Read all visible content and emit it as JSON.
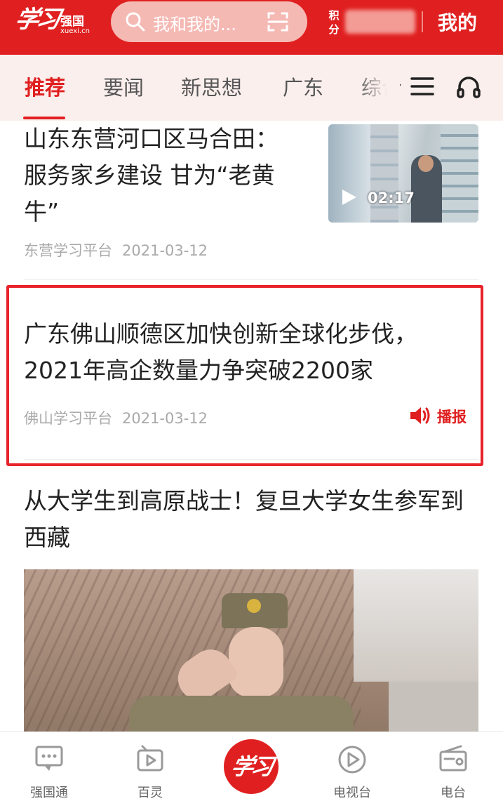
{
  "header": {
    "logo_script": "学习",
    "logo_cn": "强国",
    "logo_en": "xuexi.cn",
    "search_placeholder": "我和我的...",
    "points_label": "积分",
    "mine_label": "我的"
  },
  "tabs": [
    {
      "label": "推荐",
      "active": true
    },
    {
      "label": "要闻",
      "active": false
    },
    {
      "label": "新思想",
      "active": false
    },
    {
      "label": "广东",
      "active": false
    },
    {
      "label": "综合",
      "active": false
    }
  ],
  "feed": [
    {
      "title_lines": [
        "山东东营河口区马合田：",
        "服务家乡建设 甘为“老黄",
        "牛”"
      ],
      "source": "东营学习平台",
      "date": "2021-03-12",
      "video_duration": "02:17"
    },
    {
      "title_lines": [
        "广东佛山顺德区加快创新全球化步伐，",
        "2021年高企数量力争突破2200家"
      ],
      "source": "佛山学习平台",
      "date": "2021-03-12",
      "broadcast_label": "播报"
    },
    {
      "title_lines": [
        "从大学生到高原战士！复旦大学女生参军到",
        "西藏"
      ]
    }
  ],
  "bottom_nav": [
    {
      "label": "强国通",
      "icon": "chat-icon"
    },
    {
      "label": "百灵",
      "icon": "bailing-icon"
    },
    {
      "label": "学习",
      "icon": "xuexi-logo"
    },
    {
      "label": "电视台",
      "icon": "play-circle-icon"
    },
    {
      "label": "电台",
      "icon": "radio-icon"
    }
  ],
  "colors": {
    "brand_red": "#e02020",
    "highlight_border": "#e8232b"
  }
}
